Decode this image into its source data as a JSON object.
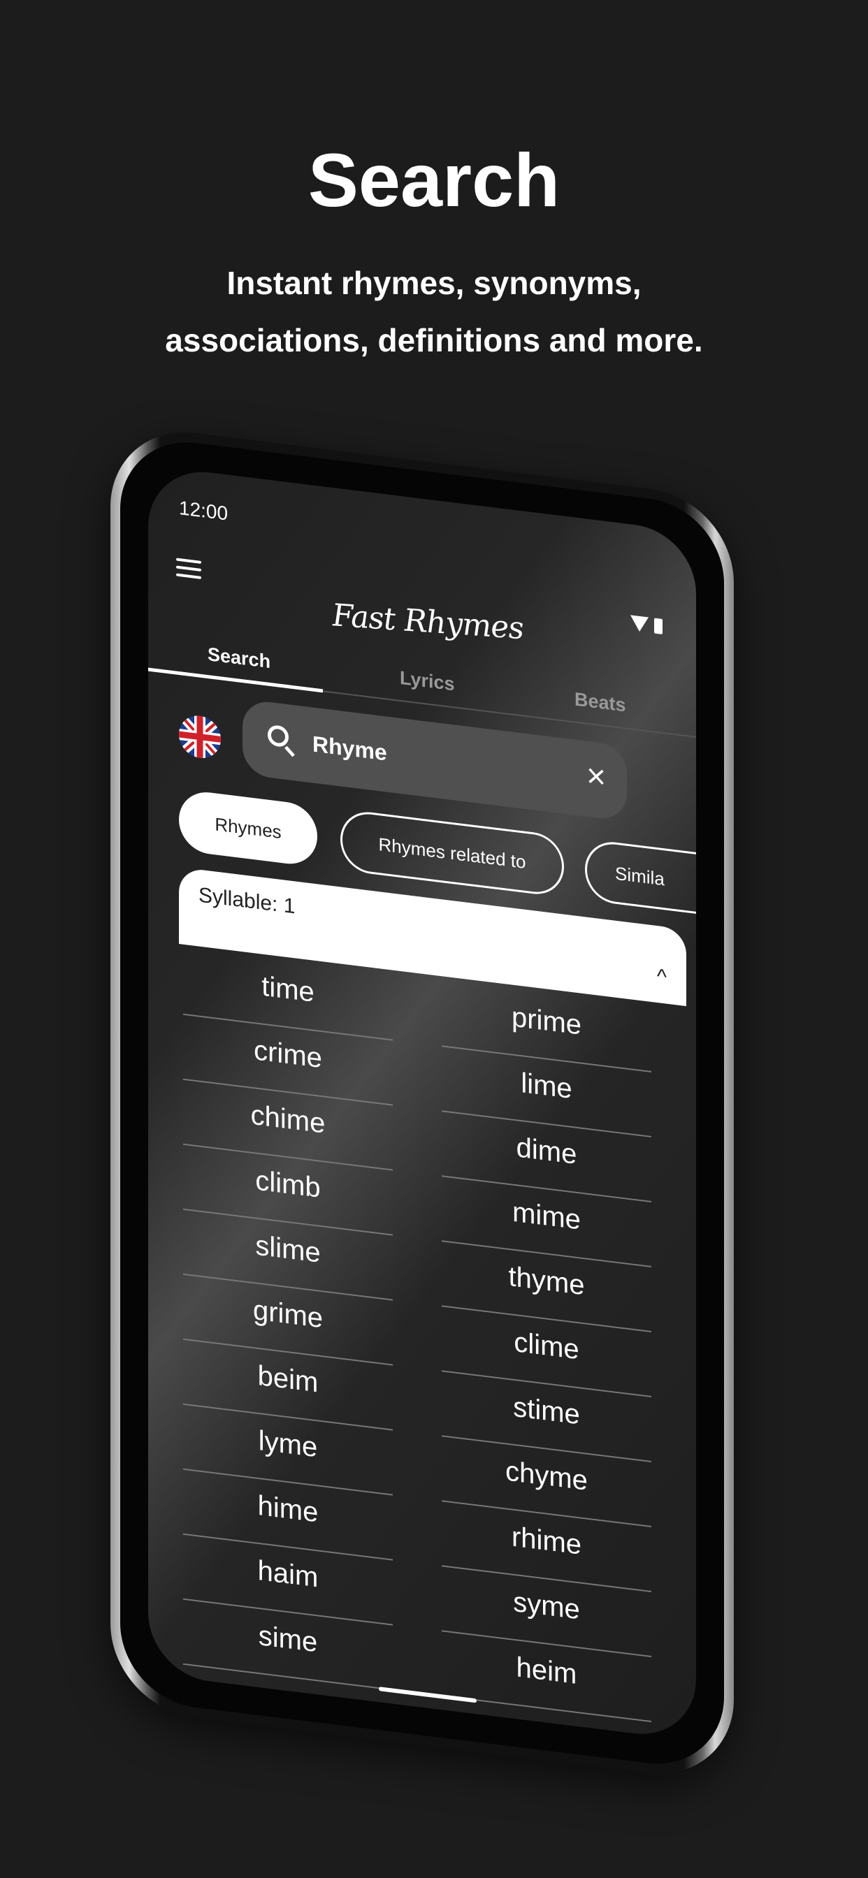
{
  "header": {
    "title": "Search",
    "subtitle_line1": "Instant rhymes, synonyms,",
    "subtitle_line2": "associations, definitions and more."
  },
  "app": {
    "status": {
      "time": "12:00"
    },
    "logo": "Fast Rhymes",
    "tabs": [
      {
        "label": "Search",
        "active": true
      },
      {
        "label": "Lyrics"
      },
      {
        "label": "Beats"
      }
    ],
    "search": {
      "value": "Rhyme",
      "language": "English (UK)"
    },
    "chips": [
      {
        "label": "Rhymes",
        "selected": true
      },
      {
        "label": "Rhymes related to"
      },
      {
        "label": "Simila"
      }
    ],
    "section": {
      "label": "Syllable: 1",
      "expanded": true
    },
    "results_left": [
      "time",
      "crime",
      "chime",
      "climb",
      "slime",
      "grime",
      "beim",
      "lyme",
      "hime",
      "haim",
      "sime"
    ],
    "results_right": [
      "prime",
      "lime",
      "dime",
      "mime",
      "thyme",
      "clime",
      "stime",
      "chyme",
      "rhime",
      "syme",
      "heim"
    ]
  }
}
